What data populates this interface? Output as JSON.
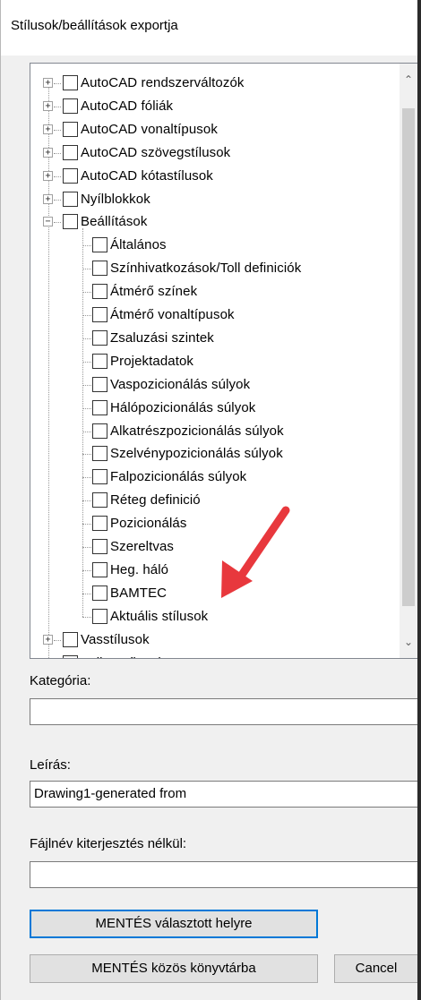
{
  "window": {
    "title": "Stílusok/beállítások exportja"
  },
  "tree": {
    "top_items": [
      {
        "label": "AutoCAD rendszerváltozók",
        "expander": "+"
      },
      {
        "label": "AutoCAD fóliák",
        "expander": "+"
      },
      {
        "label": "AutoCAD vonaltípusok",
        "expander": "+"
      },
      {
        "label": "AutoCAD szövegstílusok",
        "expander": "+"
      },
      {
        "label": "AutoCAD kótastílusok",
        "expander": "+"
      },
      {
        "label": "Nyílblokkok",
        "expander": "+"
      },
      {
        "label": "Beállítások",
        "expander": "−"
      }
    ],
    "children": [
      "Általános",
      "Színhivatkozások/Toll definiciók",
      "Átmérő színek",
      "Átmérő vonaltípusok",
      "Zsaluzási szintek",
      "Projektadatok",
      "Vaspozicionálás súlyok",
      "Hálópozicionálás súlyok",
      "Alkatrészpozicionálás súlyok",
      "Szelvénypozicionálás súlyok",
      "Falpozicionálás súlyok",
      "Réteg definició",
      "Pozicionálás",
      "Szereltvas",
      "Heg. háló",
      "BAMTEC",
      "Aktuális stílusok"
    ],
    "bottom_items": [
      {
        "label": "Vasstílusok",
        "expander": "+"
      },
      {
        "label": "Feliratstílusok",
        "expander": "+"
      }
    ]
  },
  "fields": {
    "category_label": "Kategória:",
    "category_value": "",
    "description_label": "Leírás:",
    "description_value": "Drawing1-generated from",
    "filename_label": "Fájlnév kiterjesztés nélkül:",
    "filename_value": ""
  },
  "buttons": {
    "save_selected": "MENTÉS választott helyre",
    "save_common": "MENTÉS közös könyvtárba",
    "cancel": "Cancel"
  },
  "colors": {
    "annotation_arrow": "#e8383d",
    "default_button_border": "#0078d7"
  }
}
